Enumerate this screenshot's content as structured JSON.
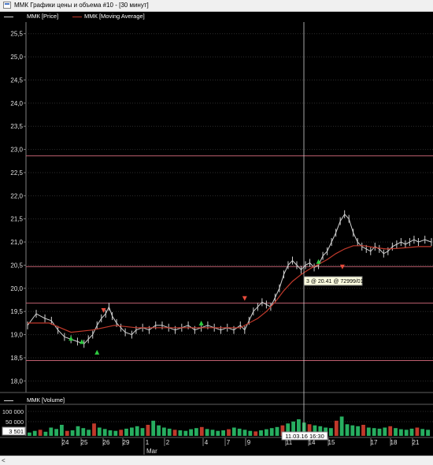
{
  "window": {
    "title": "ММК Графики цены и объема #10 - [30 минут]"
  },
  "legend_price": [
    {
      "label": "ММК [Price]",
      "color": "#d9d9d9"
    },
    {
      "label": "ММК [Moving Average]",
      "color": "#c0392b"
    }
  ],
  "legend_volume": {
    "label": "ММК [Volume]",
    "color": "#d9d9d9"
  },
  "colors": {
    "background": "#000000",
    "grid": "#2e2e2e",
    "hline": "#c06070",
    "price": "#d0d0d0",
    "ma": "#c0392b",
    "crosshair": "#d0d0d0",
    "tooltip_bg": "#ffffe1"
  },
  "crosshair": {
    "tooltip": "3 @ 20.41 @ 72999/01",
    "date_label": "11.03.16 16:30"
  },
  "volume_axis": {
    "labels": [
      "100 000",
      "50 000"
    ],
    "current": "3 501"
  },
  "chart_data": {
    "type": "line",
    "ylim": [
      17.75,
      25.75
    ],
    "yticks": [
      "25,5",
      "25,0",
      "24,5",
      "24,0",
      "23,5",
      "23,0",
      "22,5",
      "22,0",
      "21,5",
      "21,0",
      "20,5",
      "20,0",
      "19,5",
      "19,0",
      "18,5",
      "18,0"
    ],
    "horizontal_levels": [
      22.86,
      20.47,
      19.68,
      18.44
    ],
    "x_ticks": [
      "24",
      "25",
      "26",
      "29",
      "1",
      "2",
      "4",
      "7",
      "9",
      "11",
      "14",
      "15",
      "17",
      "18",
      "21"
    ],
    "x_month": "Mar",
    "price": [
      [
        0,
        19.2
      ],
      [
        8,
        19.45
      ],
      [
        16,
        19.35
      ],
      [
        22,
        19.3
      ],
      [
        28,
        19.1
      ],
      [
        34,
        18.95
      ],
      [
        40,
        18.9
      ],
      [
        46,
        18.85
      ],
      [
        52,
        18.8
      ],
      [
        56,
        18.9
      ],
      [
        60,
        19.0
      ],
      [
        64,
        19.2
      ],
      [
        68,
        19.35
      ],
      [
        72,
        19.45
      ],
      [
        75,
        19.6
      ],
      [
        78,
        19.4
      ],
      [
        82,
        19.25
      ],
      [
        86,
        19.15
      ],
      [
        90,
        19.05
      ],
      [
        96,
        19.0
      ],
      [
        100,
        19.1
      ],
      [
        106,
        19.15
      ],
      [
        112,
        19.1
      ],
      [
        118,
        19.2
      ],
      [
        124,
        19.2
      ],
      [
        130,
        19.15
      ],
      [
        136,
        19.1
      ],
      [
        142,
        19.15
      ],
      [
        148,
        19.2
      ],
      [
        154,
        19.1
      ],
      [
        160,
        19.15
      ],
      [
        166,
        19.2
      ],
      [
        172,
        19.15
      ],
      [
        178,
        19.1
      ],
      [
        184,
        19.15
      ],
      [
        190,
        19.1
      ],
      [
        196,
        19.2
      ],
      [
        200,
        19.1
      ],
      [
        204,
        19.3
      ],
      [
        208,
        19.5
      ],
      [
        212,
        19.6
      ],
      [
        216,
        19.7
      ],
      [
        220,
        19.65
      ],
      [
        224,
        19.6
      ],
      [
        228,
        19.8
      ],
      [
        232,
        20.0
      ],
      [
        236,
        20.3
      ],
      [
        240,
        20.5
      ],
      [
        244,
        20.6
      ],
      [
        248,
        20.5
      ],
      [
        252,
        20.4
      ],
      [
        256,
        20.5
      ],
      [
        260,
        20.55
      ],
      [
        264,
        20.45
      ],
      [
        268,
        20.5
      ],
      [
        272,
        20.7
      ],
      [
        276,
        20.8
      ],
      [
        280,
        21.0
      ],
      [
        284,
        21.2
      ],
      [
        288,
        21.45
      ],
      [
        292,
        21.6
      ],
      [
        296,
        21.5
      ],
      [
        300,
        21.2
      ],
      [
        304,
        21.0
      ],
      [
        308,
        20.9
      ],
      [
        312,
        20.85
      ],
      [
        316,
        20.8
      ],
      [
        320,
        20.9
      ],
      [
        324,
        20.85
      ],
      [
        328,
        20.75
      ],
      [
        332,
        20.8
      ],
      [
        336,
        20.9
      ],
      [
        340,
        20.95
      ],
      [
        344,
        21.0
      ],
      [
        348,
        20.95
      ],
      [
        352,
        21.0
      ],
      [
        356,
        21.05
      ],
      [
        360,
        21.0
      ],
      [
        366,
        21.05
      ],
      [
        372,
        21.0
      ]
    ],
    "moving_average": [
      [
        0,
        19.25
      ],
      [
        20,
        19.25
      ],
      [
        40,
        19.05
      ],
      [
        60,
        19.1
      ],
      [
        80,
        19.2
      ],
      [
        100,
        19.15
      ],
      [
        120,
        19.15
      ],
      [
        140,
        19.15
      ],
      [
        160,
        19.15
      ],
      [
        180,
        19.15
      ],
      [
        196,
        19.15
      ],
      [
        204,
        19.25
      ],
      [
        212,
        19.35
      ],
      [
        220,
        19.5
      ],
      [
        228,
        19.7
      ],
      [
        236,
        19.95
      ],
      [
        244,
        20.15
      ],
      [
        252,
        20.3
      ],
      [
        260,
        20.42
      ],
      [
        268,
        20.52
      ],
      [
        276,
        20.62
      ],
      [
        284,
        20.75
      ],
      [
        292,
        20.85
      ],
      [
        300,
        20.92
      ],
      [
        310,
        20.92
      ],
      [
        320,
        20.88
      ],
      [
        330,
        20.85
      ],
      [
        340,
        20.86
      ],
      [
        350,
        20.88
      ],
      [
        360,
        20.9
      ],
      [
        372,
        20.9
      ]
    ],
    "buy_markers": [
      [
        40,
        18.92
      ],
      [
        50,
        18.85
      ],
      [
        64,
        18.62
      ],
      [
        160,
        19.25
      ],
      [
        268,
        20.58
      ]
    ],
    "sell_markers": [
      [
        70,
        19.52
      ],
      [
        200,
        19.78
      ],
      [
        290,
        20.46
      ]
    ],
    "volume": [
      12,
      18,
      22,
      15,
      30,
      25,
      40,
      18,
      20,
      35,
      28,
      22,
      45,
      30,
      25,
      20,
      18,
      22,
      26,
      30,
      35,
      28,
      40,
      55,
      38,
      30,
      26,
      22,
      20,
      18,
      24,
      28,
      32,
      25,
      22,
      18,
      20,
      24,
      30,
      26,
      22,
      18,
      16,
      20,
      24,
      28,
      32,
      38,
      45,
      52,
      60,
      48,
      42,
      38,
      35,
      30,
      28,
      55,
      70,
      42,
      38,
      35,
      40,
      30,
      28,
      26,
      30,
      35,
      28,
      24,
      22,
      26,
      30,
      25,
      22
    ]
  }
}
